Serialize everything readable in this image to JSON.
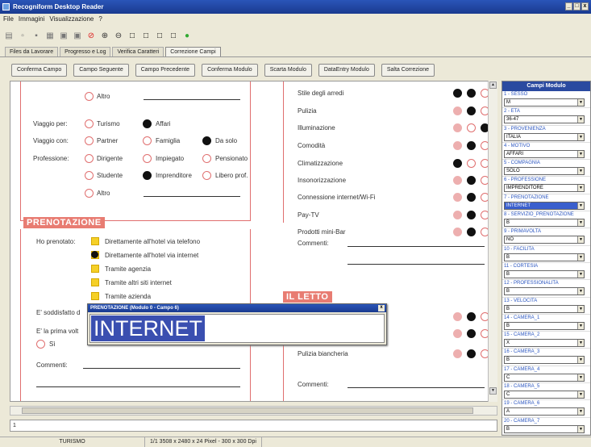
{
  "window": {
    "title": "Recogniform Desktop Reader",
    "controls": [
      "_",
      "□",
      "x"
    ]
  },
  "menu": [
    "File",
    "Immagini",
    "Visualizzazione",
    "?"
  ],
  "toolbar_icons": [
    "disk-icon",
    "open-icon",
    "save-icon",
    "print-icon",
    "scan-icon",
    "scan2-icon",
    "stop-icon",
    "zoom-in-icon",
    "zoom-out-icon",
    "page1-icon",
    "page2-icon",
    "page3-icon",
    "page4-icon",
    "ok-icon"
  ],
  "tabs": [
    "Files da Lavorare",
    "Progresso e Log",
    "Verifica Caratteri",
    "Correzione Campi"
  ],
  "active_tab": 3,
  "actions": [
    "Conferma Campo",
    "Campo Seguente",
    "Campo Precedente",
    "Conferma Modulo",
    "Scarta Modulo",
    "DataEntry Modulo",
    "Salta Correzione"
  ],
  "form": {
    "altro1": "Altro",
    "viaggio_per": {
      "label": "Viaggio per:",
      "opts": [
        "Turismo",
        "Affari"
      ]
    },
    "viaggio_con": {
      "label": "Viaggio con:",
      "opts": [
        "Partner",
        "Famiglia",
        "Da solo"
      ]
    },
    "professione": {
      "label": "Professione:",
      "opts": [
        "Dirigente",
        "Impiegato",
        "Pensionato",
        "Studente",
        "Imprenditore",
        "Libero prof.",
        "Altro"
      ]
    },
    "prenotazione_title": "PRENOTAZIONE",
    "ho_prenotato": "Ho prenotato:",
    "pren_opts": [
      "Direttamente all'hotel via telefono",
      "Direttamente all'hotel via internet",
      "Tramite agenzia",
      "Tramite altri siti internet",
      "Tramite azienda"
    ],
    "soddisfatto": "E' soddisfatto d",
    "prima_volta": "E' la prima volt",
    "si": "Sì",
    "commenti": "Commenti:",
    "right_items": [
      "Stile degli arredi",
      "Pulizia",
      "Illuminazione",
      "Comodità",
      "Climatizzazione",
      "Insonorizzazione",
      "Connessione internet/Wi-Fi",
      "Pay-TV",
      "Prodotti mini-Bar"
    ],
    "right_commenti": "Commenti:",
    "letto_title": "IL LETTO",
    "pulizia_biancheria": "Pulizia biancheria",
    "right_commenti2": "Commenti:"
  },
  "popup": {
    "title": "PRENOTAZIONE (Modulo 0 - Campo 6)",
    "value": "INTERNET"
  },
  "panel": {
    "title": "Campi Modulo",
    "fields": [
      {
        "label": "1 - SESSO",
        "value": "M"
      },
      {
        "label": "2 - ETA",
        "value": "36-47"
      },
      {
        "label": "3 - PROVENIENZA",
        "value": "ITALIA"
      },
      {
        "label": "4 - MOTIVO",
        "value": "AFFARI"
      },
      {
        "label": "5 - COMPAGNIA",
        "value": "SOLO"
      },
      {
        "label": "6 - PROFESSIONE",
        "value": "IMPRENDITORE"
      },
      {
        "label": "7 - PRENOTAZIONE",
        "value": "INTERNET"
      },
      {
        "label": "8 - SERVIZIO_PRENOTAZIONE",
        "value": "B"
      },
      {
        "label": "9 - PRIMAVOLTA",
        "value": "NO"
      },
      {
        "label": "10 - FACILITA",
        "value": "B"
      },
      {
        "label": "11 - CORTESIA",
        "value": "B"
      },
      {
        "label": "12 - PROFESSIONALITA",
        "value": "B"
      },
      {
        "label": "13 - VELOCITA",
        "value": "B"
      },
      {
        "label": "14 - CAMERA_1",
        "value": "B"
      },
      {
        "label": "15 - CAMERA_2",
        "value": "X"
      },
      {
        "label": "16 - CAMERA_3",
        "value": "B"
      },
      {
        "label": "17 - CAMERA_4",
        "value": "C"
      },
      {
        "label": "18 - CAMERA_5",
        "value": "C"
      },
      {
        "label": "19 - CAMERA_6",
        "value": "A"
      },
      {
        "label": "20 - CAMERA_7",
        "value": "B"
      }
    ]
  },
  "pager": "1",
  "status": [
    "TURISMO",
    "1/1 3508 x 2480 x 24 Pixel - 300 x 300 Dpi"
  ],
  "colors": {
    "accent": "#e87c72",
    "title": "#2a55b8",
    "selection": "#3a4fb0"
  }
}
